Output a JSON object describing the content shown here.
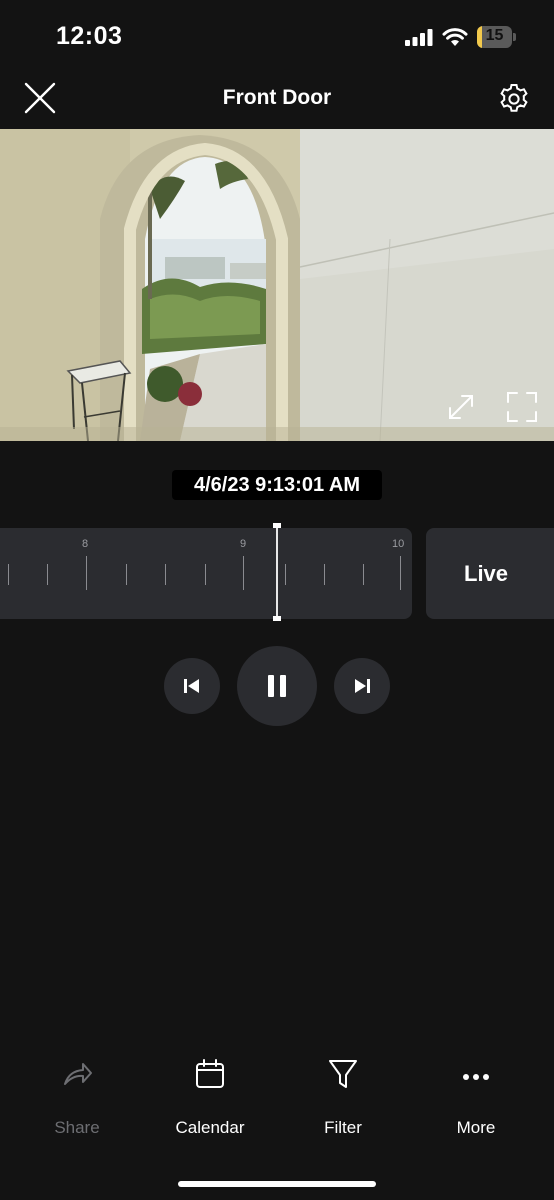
{
  "status_bar": {
    "time": "12:03",
    "battery_level": "15",
    "battery_fraction": 0.15,
    "battery_color": "#f2c94c"
  },
  "header": {
    "title": "Front Door",
    "close_icon": "close-x",
    "settings_icon": "gear"
  },
  "video": {
    "expand_icon": "diagonal-expand",
    "fullscreen_icon": "fullscreen-corners"
  },
  "playback": {
    "timestamp": "4/6/23 9:13:01 AM",
    "timeline_labels": [
      "8",
      "9",
      "10"
    ],
    "live_label": "Live",
    "controls": [
      "skip-previous",
      "pause",
      "skip-next"
    ]
  },
  "bottom_nav": {
    "items": [
      {
        "label": "Share",
        "icon": "share-arrow",
        "enabled": false
      },
      {
        "label": "Calendar",
        "icon": "calendar",
        "enabled": true
      },
      {
        "label": "Filter",
        "icon": "funnel",
        "enabled": true
      },
      {
        "label": "More",
        "icon": "ellipsis",
        "enabled": true
      }
    ]
  },
  "colors": {
    "background": "#131313",
    "panel": "#2b2c30",
    "disabled_text": "#6d6e72"
  }
}
